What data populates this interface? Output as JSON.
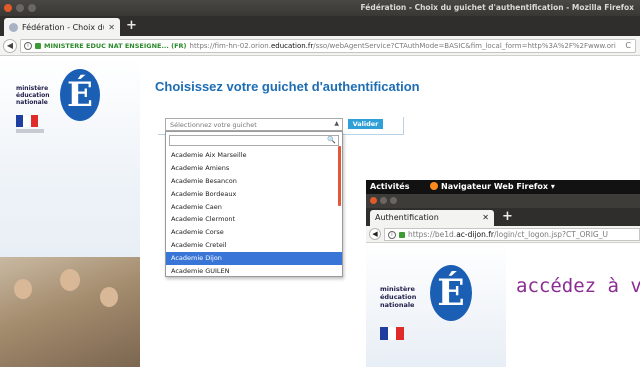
{
  "window": {
    "title": "Fédération - Choix du guichet d'authentification - Mozilla Firefox"
  },
  "tabs": [
    {
      "label": "Fédération - Choix du g"
    }
  ],
  "address": {
    "identity": "MINISTERE EDUC NAT ENSEIGNE... (FR)",
    "url_prefix": "https://fim-hn-02.orion.",
    "url_domain": "education.fr",
    "url_suffix": "/sso/webAgentService?CTAuthMode=BASIC&fim_local_form=http%3A%2F%2Fwww.ori"
  },
  "sidebar": {
    "logo_lines": [
      "ministère",
      "éducation",
      "nationale"
    ],
    "logo_letter": "É"
  },
  "main": {
    "heading": "Choisissez votre guichet d'authentification",
    "select_placeholder": "Sélectionnez votre guichet",
    "submit_label": "Valider"
  },
  "dropdown": {
    "options": [
      "Academie Aix Marseille",
      "Academie Amiens",
      "Academie Besancon",
      "Academie Bordeaux",
      "Academie Caen",
      "Academie Clermont",
      "Academie Corse",
      "Academie Creteil",
      "Academie Dijon",
      "Academie GUILEN"
    ],
    "selected_index": 8
  },
  "overlay": {
    "activities_label": "Activités",
    "app_label": "Navigateur Web Firefox ▾",
    "tab_label": "Authentification",
    "url_prefix": "https://be1d.",
    "url_domain": "ac-dijon.fr",
    "url_suffix": "/login/ct_logon.jsp?CT_ORIG_U",
    "logo_lines": [
      "ministère",
      "éducation",
      "nationale"
    ],
    "logo_letter": "É",
    "tagline": "accédez à v"
  },
  "colors": {
    "heading": "#1d6db4",
    "button": "#2f9fd8",
    "selection": "#3875d7",
    "tagline": "#8b2c93",
    "close_button": "#e05a2b"
  }
}
